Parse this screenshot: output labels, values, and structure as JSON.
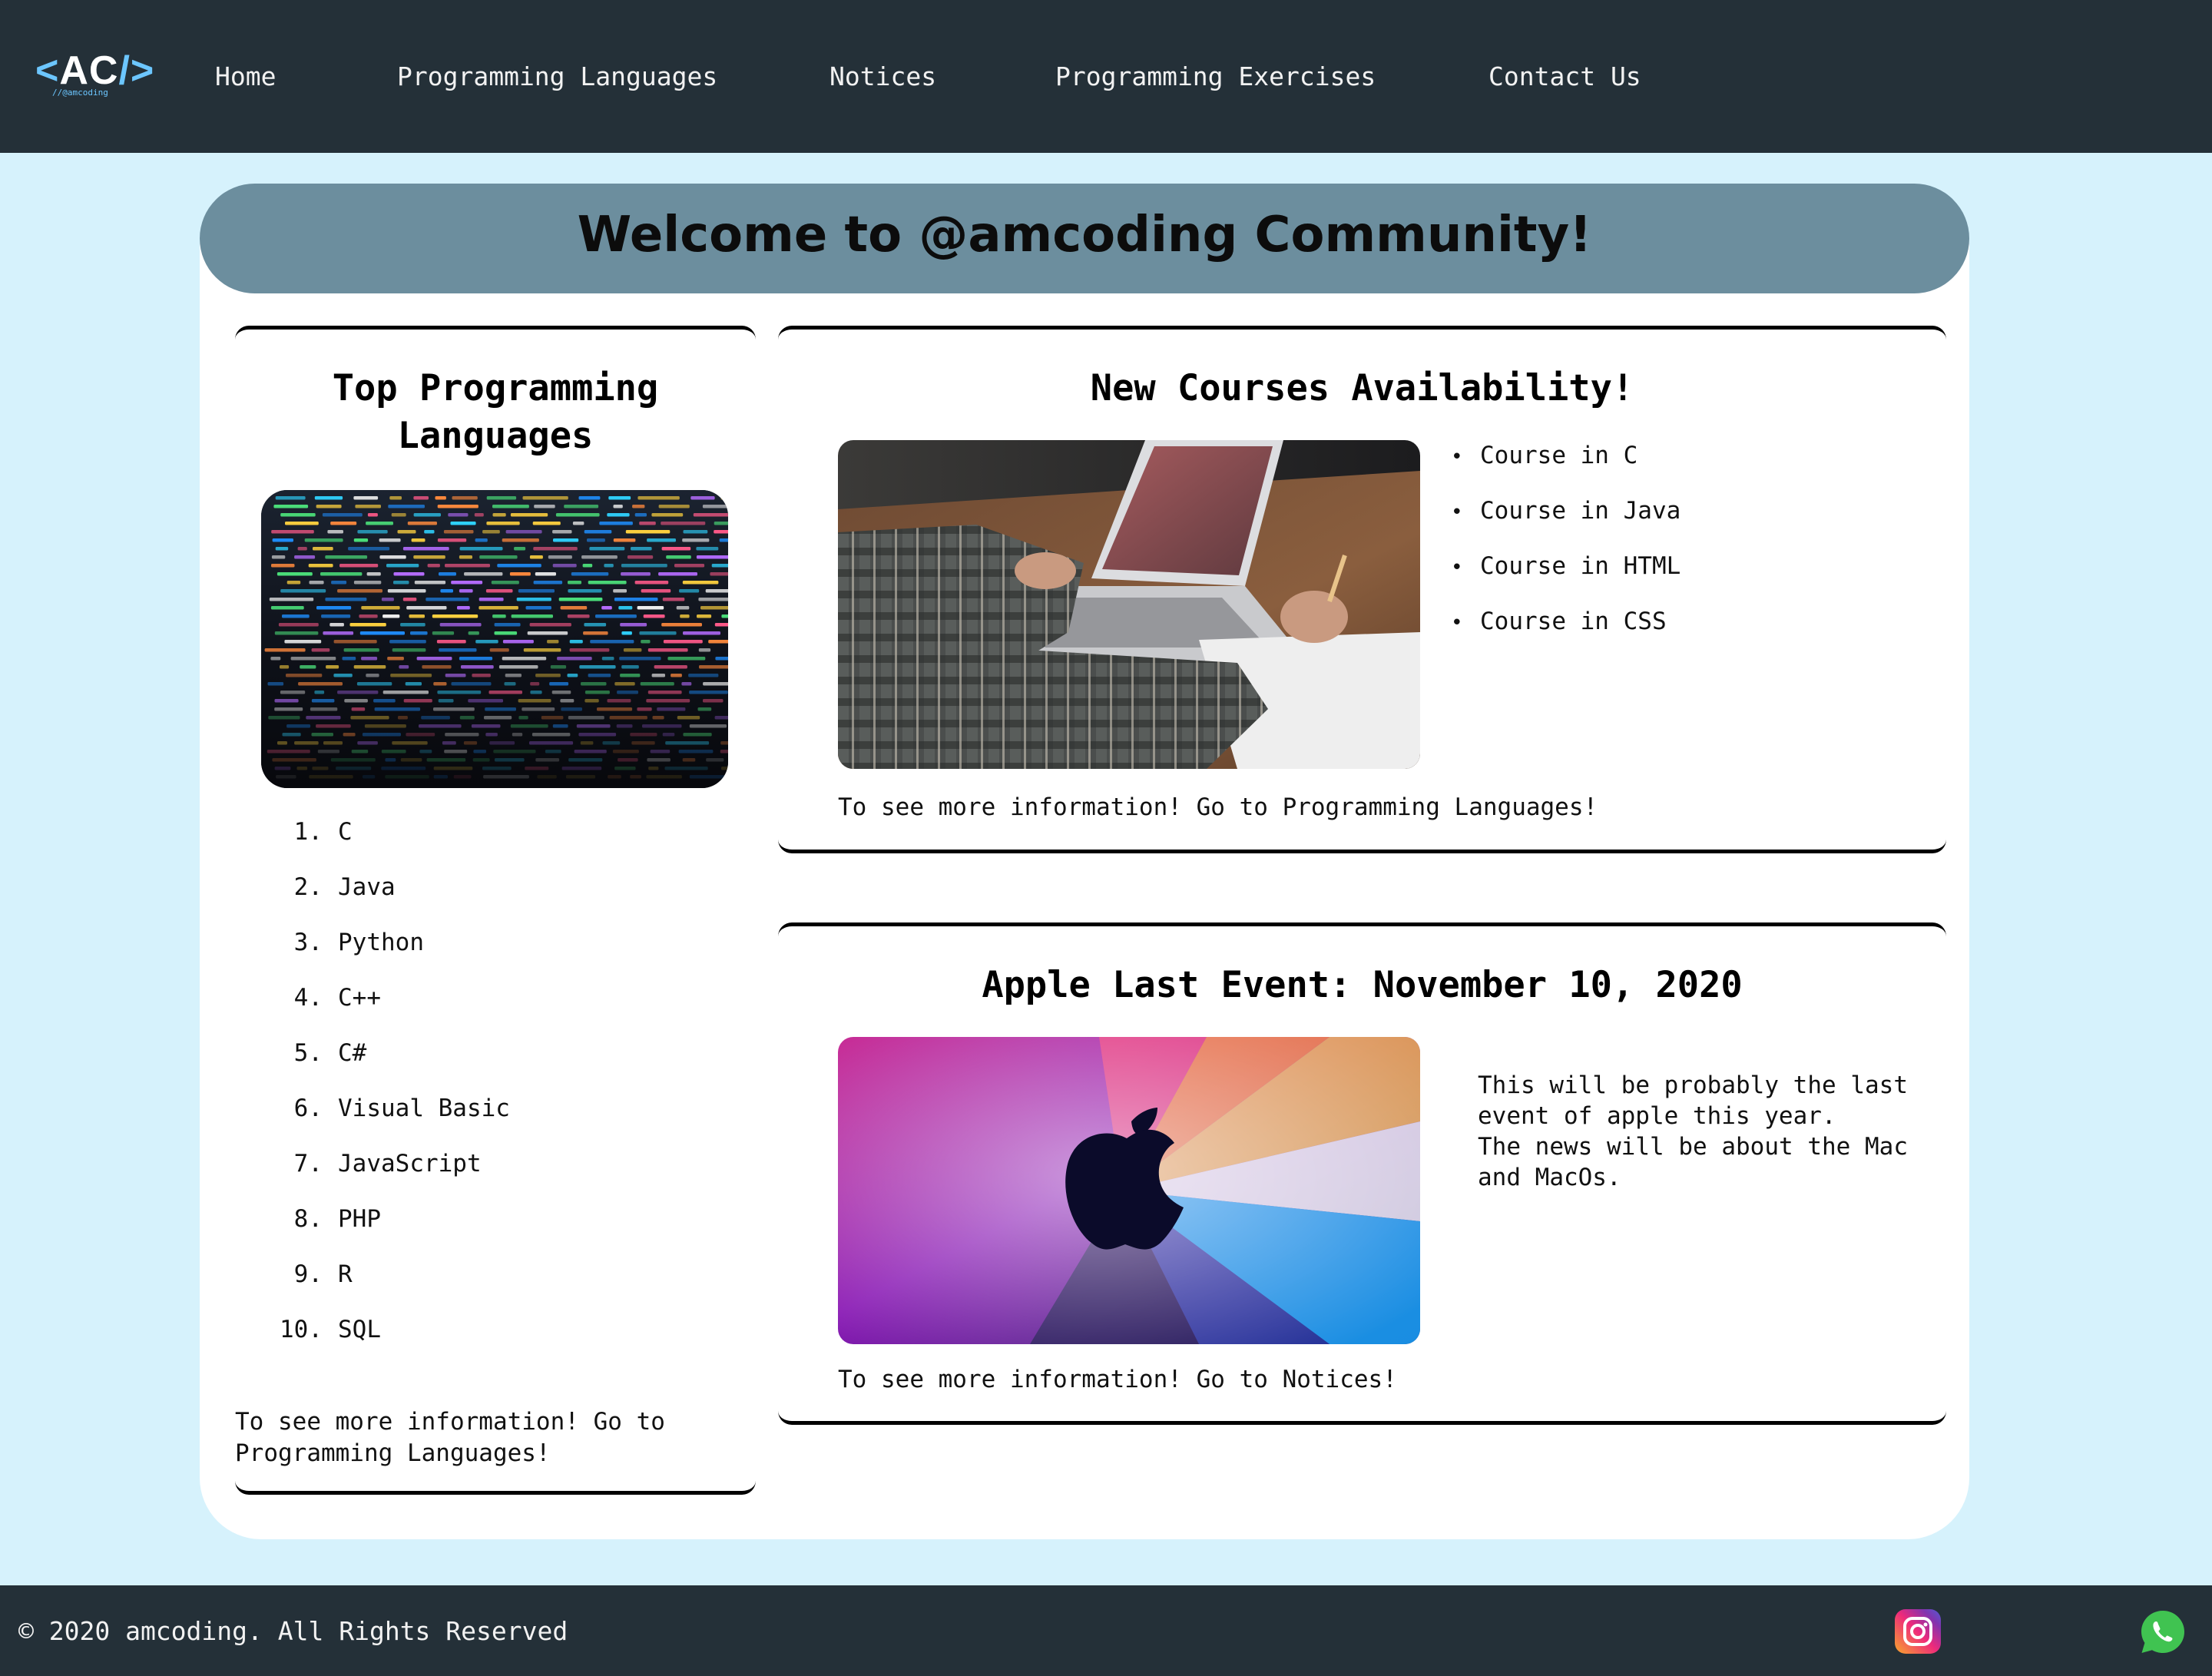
{
  "nav": {
    "logo_text": "AC",
    "logo_open": "<",
    "logo_close": "/>",
    "logo_sub": "//@amcoding",
    "links": [
      "Home",
      "Programming Languages",
      "Notices",
      "Programming Exercises",
      "Contact Us"
    ]
  },
  "welcome": {
    "title": "Welcome to @amcoding Community!"
  },
  "top_languages": {
    "title_line1": "Top Programming",
    "title_line2": "Languages",
    "items": [
      {
        "num": "1.",
        "name": "C"
      },
      {
        "num": "2.",
        "name": "Java"
      },
      {
        "num": "3.",
        "name": "Python"
      },
      {
        "num": "4.",
        "name": "C++"
      },
      {
        "num": "5.",
        "name": "C#"
      },
      {
        "num": "6.",
        "name": "Visual Basic"
      },
      {
        "num": "7.",
        "name": "JavaScript"
      },
      {
        "num": "8.",
        "name": "PHP"
      },
      {
        "num": "9.",
        "name": "R"
      },
      {
        "num": "10.",
        "name": "SQL"
      }
    ],
    "more_line1": "To see more information! Go to",
    "more_line2": "Programming Languages!"
  },
  "courses": {
    "title": "New Courses Availability!",
    "items": [
      "Course in C",
      "Course in Java",
      "Course in HTML",
      "Course in CSS"
    ],
    "bullet": "•",
    "more": "To see more information! Go to Programming Languages!"
  },
  "apple": {
    "title": "Apple Last Event: November 10, 2020",
    "desc_line1": "This will be probably the last event of apple this year.",
    "desc_line2": "The news will be about the Mac and MacOs.",
    "more": "To see more information! Go to Notices!"
  },
  "footer": {
    "copyright": "© 2020 amcoding. All Rights Reserved",
    "icons": [
      "instagram-icon",
      "whatsapp-icon"
    ]
  },
  "colors": {
    "nav_bg": "#243038",
    "page_bg": "#d6f2fc",
    "welcome_bg": "#6c8e9e",
    "logo_accent": "#6cc6ff"
  }
}
